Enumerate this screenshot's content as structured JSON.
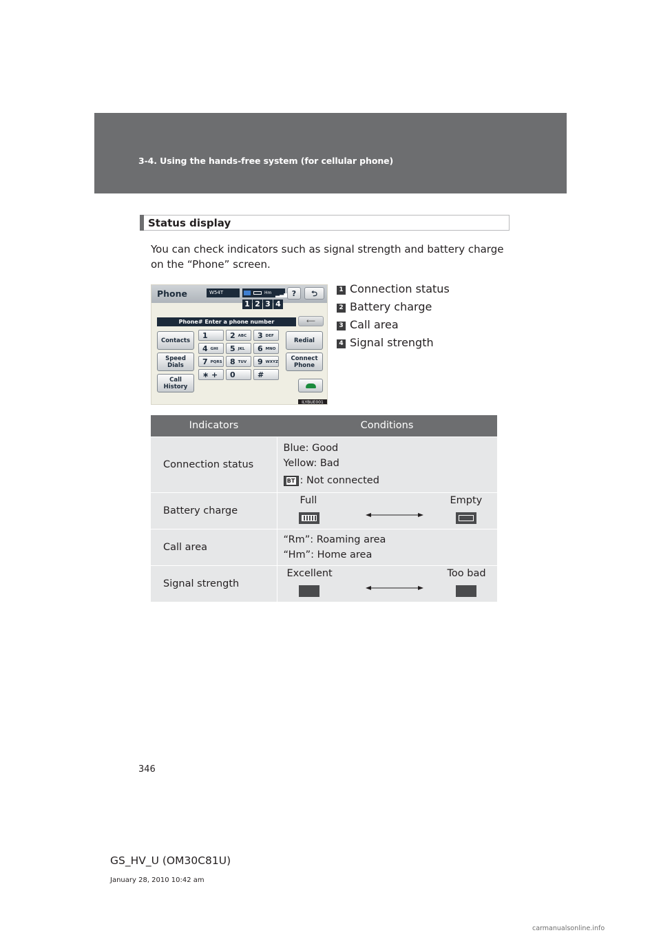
{
  "header": {
    "breadcrumb": "3-4. Using the hands-free system (for cellular phone)"
  },
  "section": {
    "title": "Status display",
    "intro": "You can check indicators such as signal strength and battery charge on the “Phone” screen."
  },
  "screenshot": {
    "title": "Phone",
    "model": "W54T",
    "status_text": "Hm",
    "badges": [
      "1",
      "2",
      "3",
      "4"
    ],
    "help_label": "?",
    "back_label": "⮌",
    "entry_label": "Phone# Enter a phone number",
    "delete_label": "⟵",
    "left_buttons": [
      "Contacts",
      "Speed Dials",
      "Call History"
    ],
    "right_buttons": [
      "Redial",
      "Connect Phone"
    ],
    "keys": [
      {
        "num": "1",
        "sub": ""
      },
      {
        "num": "2",
        "sub": "ABC"
      },
      {
        "num": "3",
        "sub": "DEF"
      },
      {
        "num": "4",
        "sub": "GHI"
      },
      {
        "num": "5",
        "sub": "JKL"
      },
      {
        "num": "6",
        "sub": "MNO"
      },
      {
        "num": "7",
        "sub": "PQRS"
      },
      {
        "num": "8",
        "sub": "TUV"
      },
      {
        "num": "9",
        "sub": "WXYZ"
      },
      {
        "num": "∗ +",
        "sub": ""
      },
      {
        "num": "0",
        "sub": ""
      },
      {
        "num": "#",
        "sub": ""
      }
    ],
    "image_code": "ILYBUE001"
  },
  "legend": [
    {
      "num": "1",
      "label": "Connection status"
    },
    {
      "num": "2",
      "label": "Battery charge"
    },
    {
      "num": "3",
      "label": "Call area"
    },
    {
      "num": "4",
      "label": "Signal strength"
    }
  ],
  "table": {
    "headers": [
      "Indicators",
      "Conditions"
    ],
    "connection": {
      "name": "Connection status",
      "good": "Blue: Good",
      "bad": "Yellow: Bad",
      "not_connected": ": Not connected",
      "icon": "bt-icon"
    },
    "battery": {
      "name": "Battery charge",
      "left": "Full",
      "right": "Empty"
    },
    "call_area": {
      "name": "Call area",
      "roaming": "“Rm”: Roaming area",
      "home": "“Hm”: Home area"
    },
    "signal": {
      "name": "Signal strength",
      "left": "Excellent",
      "right": "Too bad"
    }
  },
  "footer": {
    "page_number": "346",
    "doc_id": "GS_HV_U (OM30C81U)",
    "date": "January 28, 2010 10:42 am",
    "watermark": "carmanualsonline.info"
  },
  "colors": {
    "header_band": "#6d6e70",
    "table_header": "#6d6e70",
    "table_cell": "#e6e7e8"
  }
}
